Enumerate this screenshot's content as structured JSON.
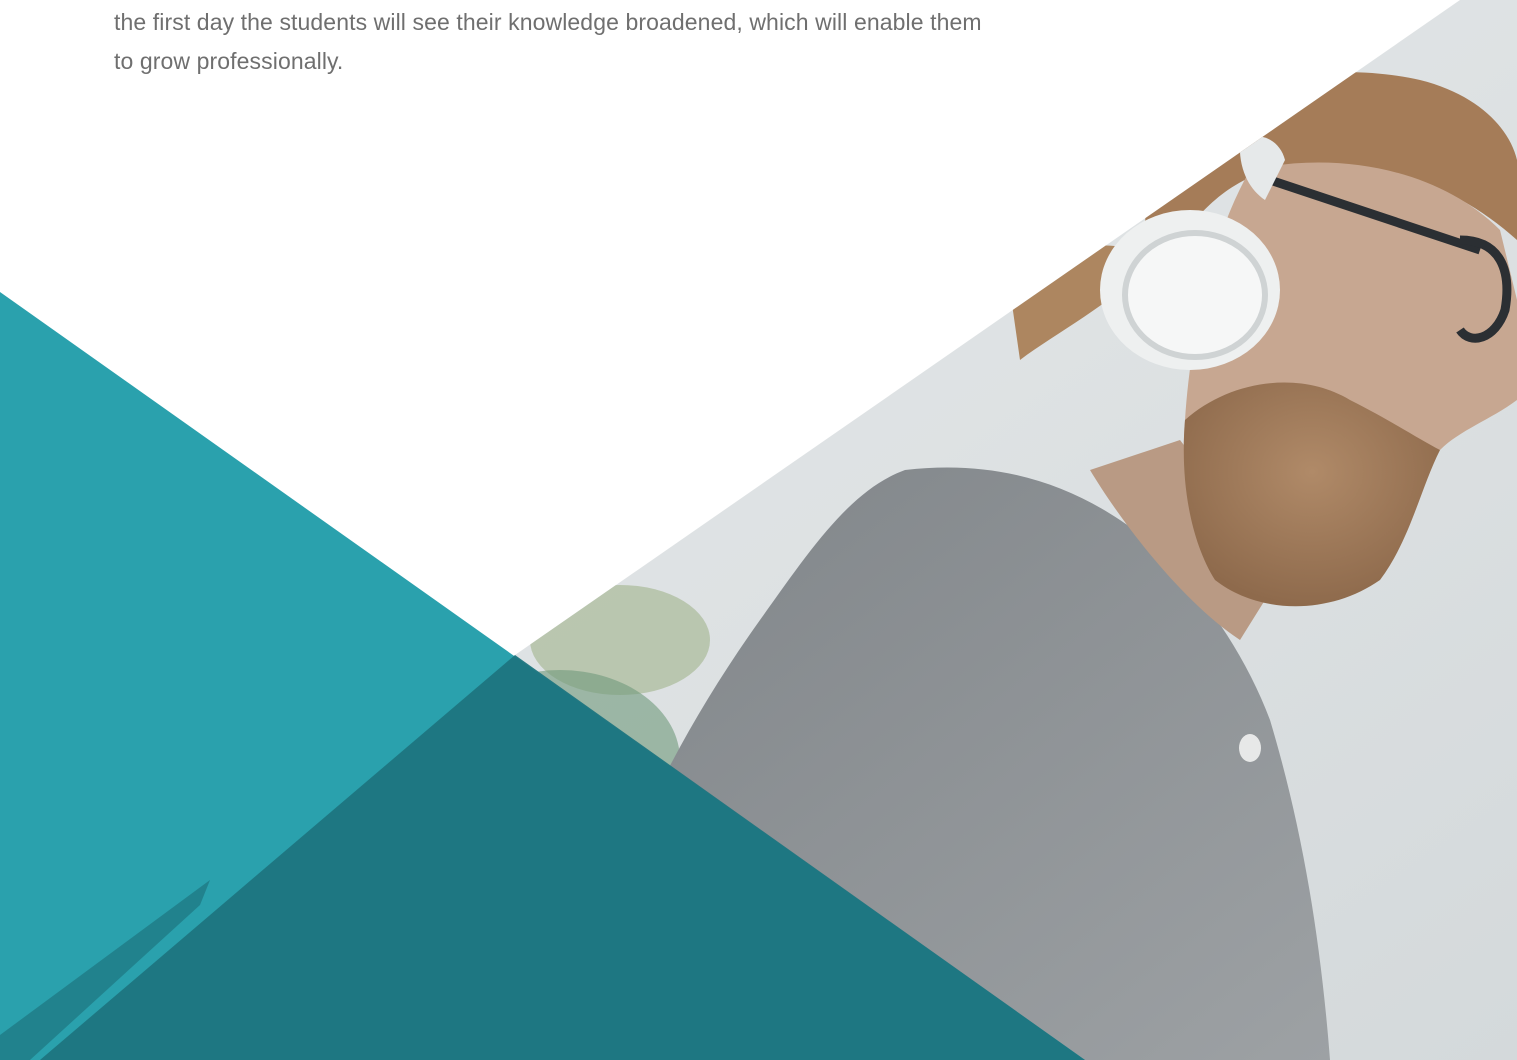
{
  "intro": {
    "line_1": "the first day the students will see their knowledge broadened, which will enable them",
    "line_2": "to grow professionally."
  },
  "colors": {
    "teal_light": "#2aa1ad",
    "teal_dark": "#1e7580",
    "photo_wall": "#dfe3e4",
    "shirt": "#8f9397",
    "skin": "#c4a58f",
    "hair": "#a07a58",
    "beard": "#a07a5c",
    "headphone": "#eef0f0",
    "glasses": "#2b2f33",
    "plant": "#7fa07a"
  },
  "icons": {
    "headphones": "headphones-icon"
  }
}
